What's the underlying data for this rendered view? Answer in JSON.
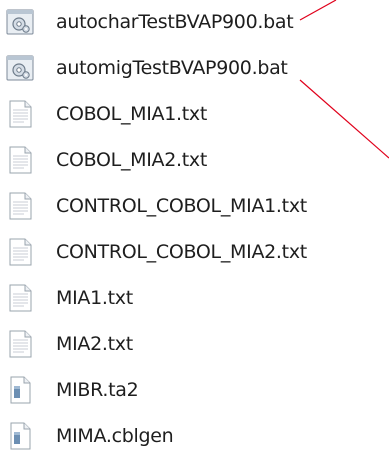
{
  "files": [
    {
      "name": "autocharTestBVAP900.bat",
      "icon": "batch-file-icon"
    },
    {
      "name": "automigTestBVAP900.bat",
      "icon": "batch-file-icon"
    },
    {
      "name": "COBOL_MIA1.txt",
      "icon": "text-file-icon"
    },
    {
      "name": "COBOL_MIA2.txt",
      "icon": "text-file-icon"
    },
    {
      "name": "CONTROL_COBOL_MIA1.txt",
      "icon": "text-file-icon"
    },
    {
      "name": "CONTROL_COBOL_MIA2.txt",
      "icon": "text-file-icon"
    },
    {
      "name": "MIA1.txt",
      "icon": "text-file-icon"
    },
    {
      "name": "MIA2.txt",
      "icon": "text-file-icon"
    },
    {
      "name": "MIBR.ta2",
      "icon": "generic-file-icon"
    },
    {
      "name": "MIMA.cblgen",
      "icon": "generic-file-icon"
    }
  ],
  "colors": {
    "annotation_line": "#e0001b",
    "text": "#1e1e1e"
  }
}
